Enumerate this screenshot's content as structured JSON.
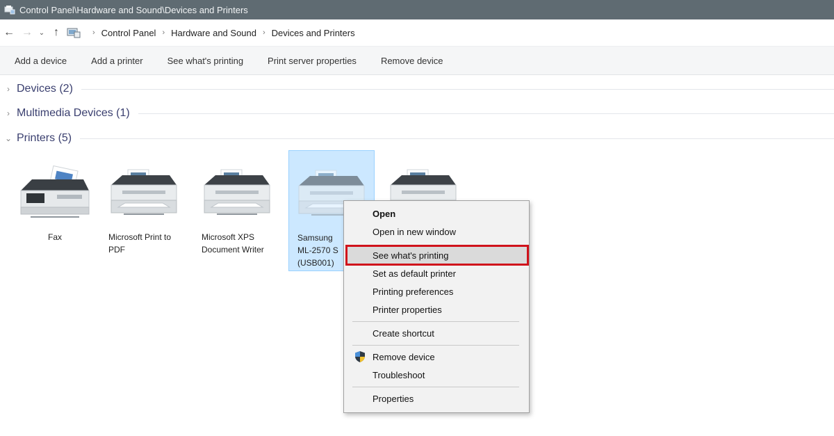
{
  "window": {
    "title": "Control Panel\\Hardware and Sound\\Devices and Printers"
  },
  "nav": {
    "back_icon": "back-arrow-icon",
    "forward_icon": "forward-arrow-icon",
    "recent_icon": "chevron-down-icon",
    "up_icon": "up-arrow-icon",
    "breadcrumb": [
      "Control Panel",
      "Hardware and Sound",
      "Devices and Printers"
    ]
  },
  "commands": [
    "Add a device",
    "Add a printer",
    "See what's printing",
    "Print server properties",
    "Remove device"
  ],
  "groups": {
    "devices": "Devices (2)",
    "multimedia": "Multimedia Devices (1)",
    "printers": "Printers (5)"
  },
  "printers": [
    {
      "label": "Fax",
      "icon": "fax-icon"
    },
    {
      "label": "Microsoft Print to PDF",
      "icon": "printer-icon"
    },
    {
      "label": "Microsoft XPS Document Writer",
      "icon": "printer-icon"
    },
    {
      "label": "Samsung ML-2570 S (USB001)",
      "icon": "printer-icon",
      "selected": true
    },
    {
      "label": "",
      "icon": "printer-icon"
    }
  ],
  "context_menu": {
    "items": [
      {
        "label": "Open",
        "bold": true
      },
      {
        "label": "Open in new window"
      },
      {
        "label": "See what's printing",
        "highlighted": true
      },
      {
        "label": "Set as default printer"
      },
      {
        "label": "Printing preferences"
      },
      {
        "label": "Printer properties"
      },
      {
        "label": "Create shortcut"
      },
      {
        "label": "Remove device",
        "icon": "admin-shield-icon"
      },
      {
        "label": "Troubleshoot"
      },
      {
        "label": "Properties"
      }
    ]
  },
  "colors": {
    "titlebar": "#5f6b72",
    "selection": "#cce8ff",
    "highlight_border": "#d0121b",
    "group_text": "#3a3f6f"
  }
}
